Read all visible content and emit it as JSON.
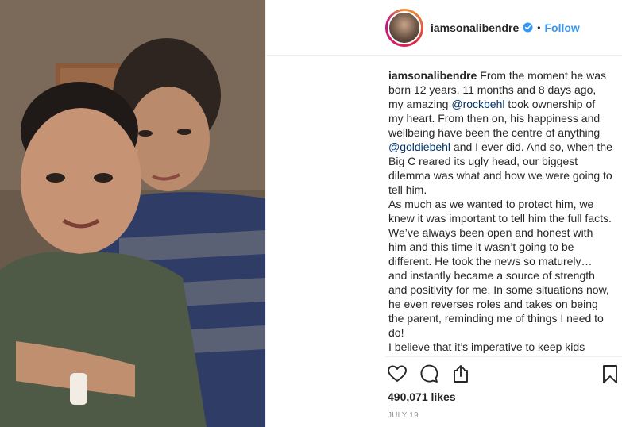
{
  "post": {
    "username": "iamsonalibendre",
    "follow_label": "Follow",
    "separator": "•",
    "caption": {
      "author": "iamsonalibendre",
      "p1_a": "From the moment he was born 12 years, 11 months and 8 days ago, my amazing ",
      "mention1": "@rockbehl",
      "p1_b": " took ownership of my heart. From then on, his happiness and wellbeing have been the centre of anything ",
      "mention2": "@goldiebehl",
      "p1_c": " and I ever did. And so, when the Big C reared its ugly head, our biggest dilemma was what and how we were going to tell him.",
      "p2": "As much as we wanted to protect him, we knew it was important to tell him the full facts. We’ve always been open and honest with him and this time it wasn’t going to be different. He took the news so maturely… and instantly became a source of strength and positivity for me. In some situations now, he even reverses roles and takes on being the parent, reminding me of things I need to do!",
      "p3": "I believe that it’s imperative to keep kids"
    },
    "likes": "490,071 likes",
    "date": "JULY 19"
  },
  "icons": {
    "like": "heart-icon",
    "comment": "comment-icon",
    "share": "share-icon",
    "save": "bookmark-icon",
    "verified": "verified-badge-icon"
  },
  "colors": {
    "link_blue": "#3897f0",
    "mention": "#003569",
    "verified": "#3897f0",
    "text": "#262626",
    "muted": "#999999"
  }
}
